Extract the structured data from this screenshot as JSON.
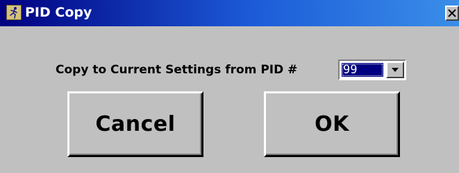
{
  "window": {
    "title": "PID Copy",
    "icon": "runner-app-icon",
    "close_icon": "close-icon"
  },
  "form": {
    "prompt_label": "Copy to Current Settings from PID #",
    "pid_select": {
      "selected_value": "99",
      "dropdown_icon": "chevron-down-icon"
    }
  },
  "buttons": {
    "cancel_label": "Cancel",
    "ok_label": "OK"
  },
  "colors": {
    "titlebar_start": "#000080",
    "titlebar_end": "#3a8ee8",
    "face": "#c0c0c0",
    "selection": "#000080"
  }
}
